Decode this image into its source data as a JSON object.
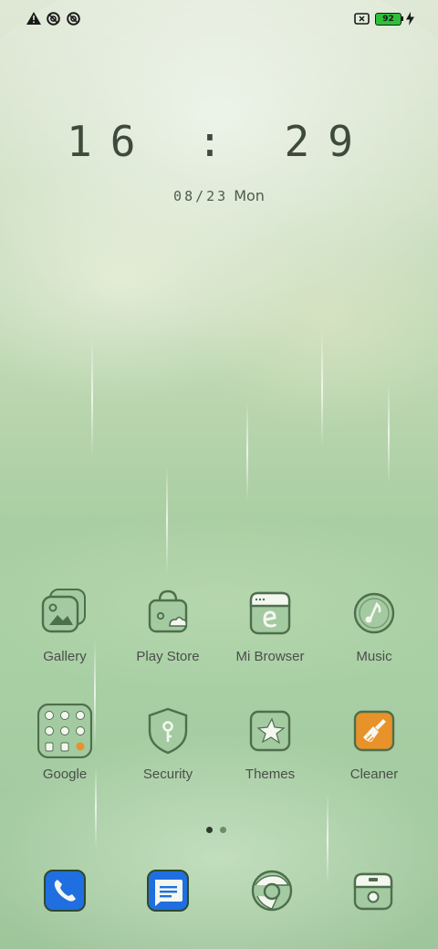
{
  "status_bar": {
    "left_icons": [
      "warning-icon",
      "do-not-disturb-icon",
      "data-saver-icon"
    ],
    "right_icons": [
      "no-sim-icon",
      "battery-icon",
      "charging-bolt-icon"
    ],
    "battery_level": "92",
    "colors": {
      "battery_fill": "#2dbf3a",
      "icon": "#1a1a1a"
    }
  },
  "lockclock": {
    "time": "16 : 29",
    "date": "08/23",
    "weekday": "Mon"
  },
  "apps_row1": [
    {
      "label": "Gallery",
      "icon": "gallery-icon"
    },
    {
      "label": "Play Store",
      "icon": "play-store-icon"
    },
    {
      "label": "Mi Browser",
      "icon": "browser-icon"
    },
    {
      "label": "Music",
      "icon": "music-icon"
    }
  ],
  "apps_row2": [
    {
      "label": "Google",
      "icon": "google-folder-icon"
    },
    {
      "label": "Security",
      "icon": "security-shield-icon"
    },
    {
      "label": "Themes",
      "icon": "themes-star-icon"
    },
    {
      "label": "Cleaner",
      "icon": "cleaner-brush-icon"
    }
  ],
  "page_indicator": {
    "pages": 2,
    "active": 1
  },
  "dock": [
    {
      "icon": "phone-icon"
    },
    {
      "icon": "messages-icon"
    },
    {
      "icon": "chrome-icon"
    },
    {
      "icon": "camera-icon"
    }
  ],
  "theme_colors": {
    "icon_fill": "#a3caa0",
    "icon_stroke": "#4e6f4c",
    "dock_blue": "#1f6fe0",
    "cleaner_orange": "#e8922a"
  }
}
